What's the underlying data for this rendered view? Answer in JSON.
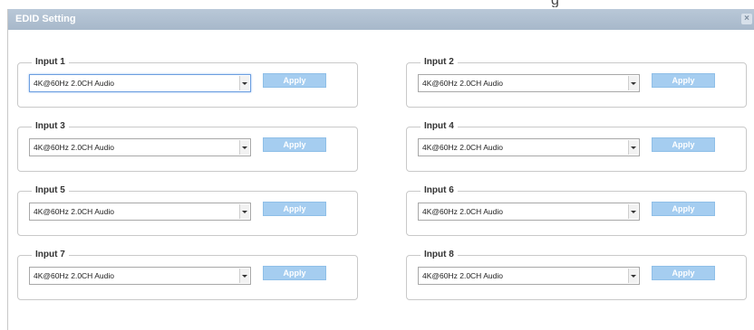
{
  "background_glyph": "g",
  "dialog": {
    "title": "EDID Setting",
    "close_icon": "×"
  },
  "inputs": [
    {
      "label": "Input 1",
      "selected": "4K@60Hz 2.0CH Audio",
      "apply_label": "Apply",
      "focused": true
    },
    {
      "label": "Input 2",
      "selected": "4K@60Hz 2.0CH Audio",
      "apply_label": "Apply",
      "focused": false
    },
    {
      "label": "Input 3",
      "selected": "4K@60Hz 2.0CH Audio",
      "apply_label": "Apply",
      "focused": false
    },
    {
      "label": "Input 4",
      "selected": "4K@60Hz 2.0CH Audio",
      "apply_label": "Apply",
      "focused": false
    },
    {
      "label": "Input 5",
      "selected": "4K@60Hz 2.0CH Audio",
      "apply_label": "Apply",
      "focused": false
    },
    {
      "label": "Input 6",
      "selected": "4K@60Hz 2.0CH Audio",
      "apply_label": "Apply",
      "focused": false
    },
    {
      "label": "Input 7",
      "selected": "4K@60Hz 2.0CH Audio",
      "apply_label": "Apply",
      "focused": false
    },
    {
      "label": "Input 8",
      "selected": "4K@60Hz 2.0CH Audio",
      "apply_label": "Apply",
      "focused": false
    }
  ],
  "colors": {
    "titlebar": "#aabbcd",
    "apply_button": "#a5cdf0",
    "focus_border": "#6d9fe0"
  }
}
